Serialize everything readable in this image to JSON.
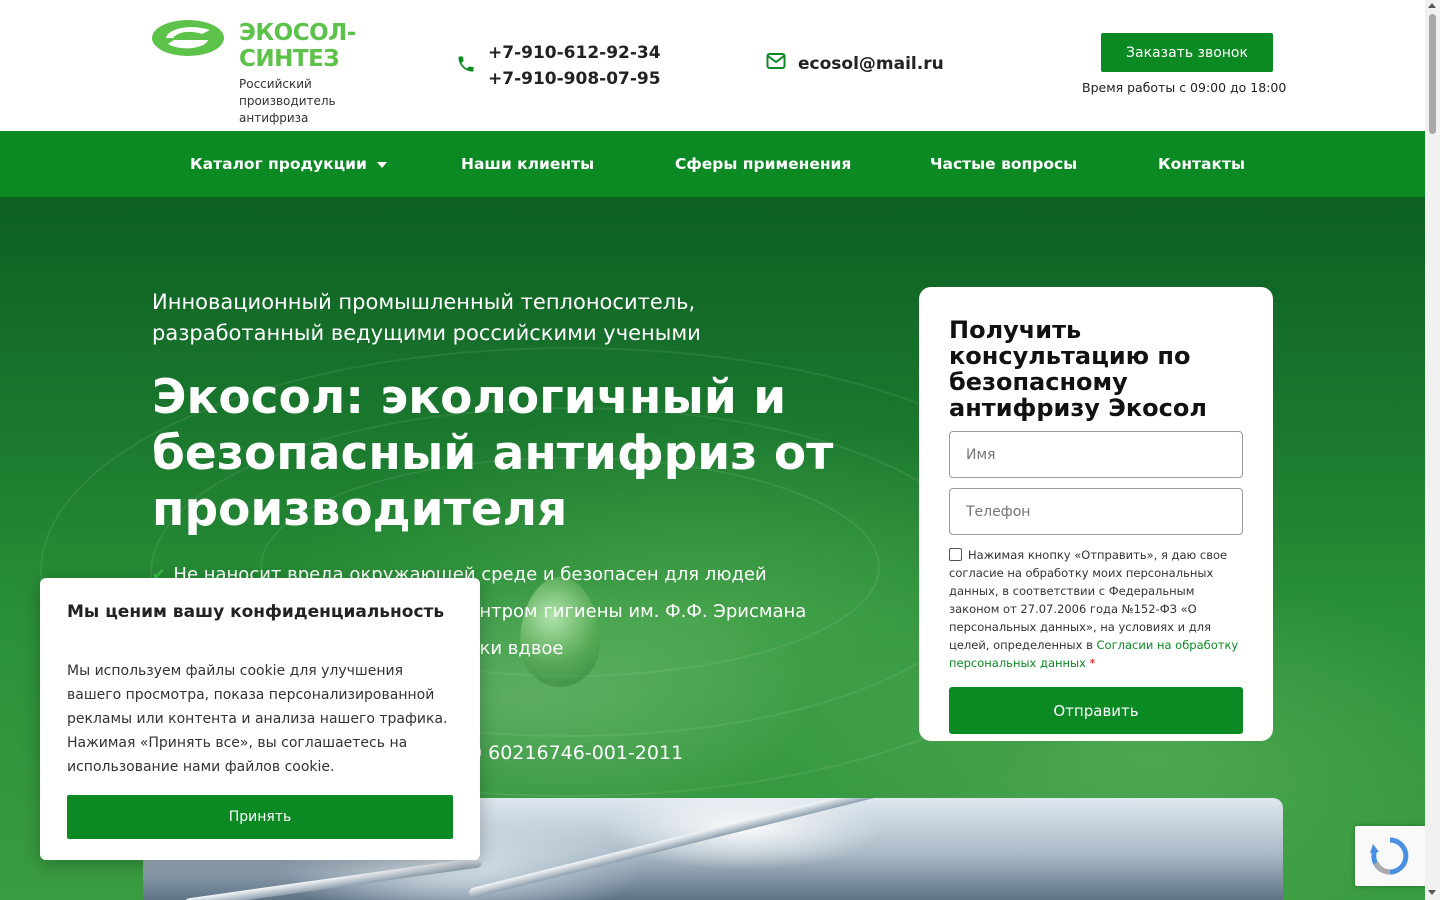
{
  "brand": {
    "name_line1": "ЭКОСОЛ-",
    "name_line2": "СИНТЕЗ",
    "tagline": "Российский производитель антифриза",
    "accent_color": "#0b8a24",
    "logo_color": "#5cc24a"
  },
  "contacts": {
    "phone_icon": "phone-icon",
    "phone1": "+7-910-612-92-34",
    "phone2": "+7-910-908-07-95",
    "email_icon": "envelope-icon",
    "email": "ecosol@mail.ru",
    "call_button": "Заказать звонок",
    "hours": "Время работы с 09:00 до 18:00"
  },
  "nav": {
    "items": [
      {
        "label": "Каталог продукции",
        "has_dropdown": true
      },
      {
        "label": "Наши клиенты"
      },
      {
        "label": "Сферы применения"
      },
      {
        "label": "Частые вопросы"
      },
      {
        "label": "Контакты"
      }
    ]
  },
  "hero": {
    "subtitle": "Инновационный промышленный теплоноситель, разработанный ведущими российскими учеными",
    "title": "Экосол: экологичный и безопасный антифриз от производителя",
    "features": [
      "Не наносит вреда окружающей среде и безопасен для людей",
      "центром гигиены им. Ф.Ф. Эрисмана",
      "ники вдвое"
    ],
    "certificate": "0 60216746-001-2011"
  },
  "form": {
    "title": "Получить консультацию по безопасному антифризу Экосол",
    "name_placeholder": "Имя",
    "phone_placeholder": "Телефон",
    "consent_text": "Нажимая кнопку «Отправить», я даю свое согласие на обработку моих персональных данных, в соответствии с Федеральным законом от 27.07.2006 года №152-ФЗ «О персональных данных», на условиях и для целей, определенных в",
    "consent_link": "Согласии на обработку персональных данных",
    "required_mark": "*",
    "submit": "Отправить"
  },
  "cookie": {
    "title": "Мы ценим вашу конфиденциальность",
    "text": "Мы используем файлы cookie для улучшения вашего просмотра, показа персонализированной рекламы или контента и анализа нашего трафика. Нажимая «Принять все», вы соглашаетесь на использование нами файлов cookie.",
    "accept": "Принять"
  }
}
